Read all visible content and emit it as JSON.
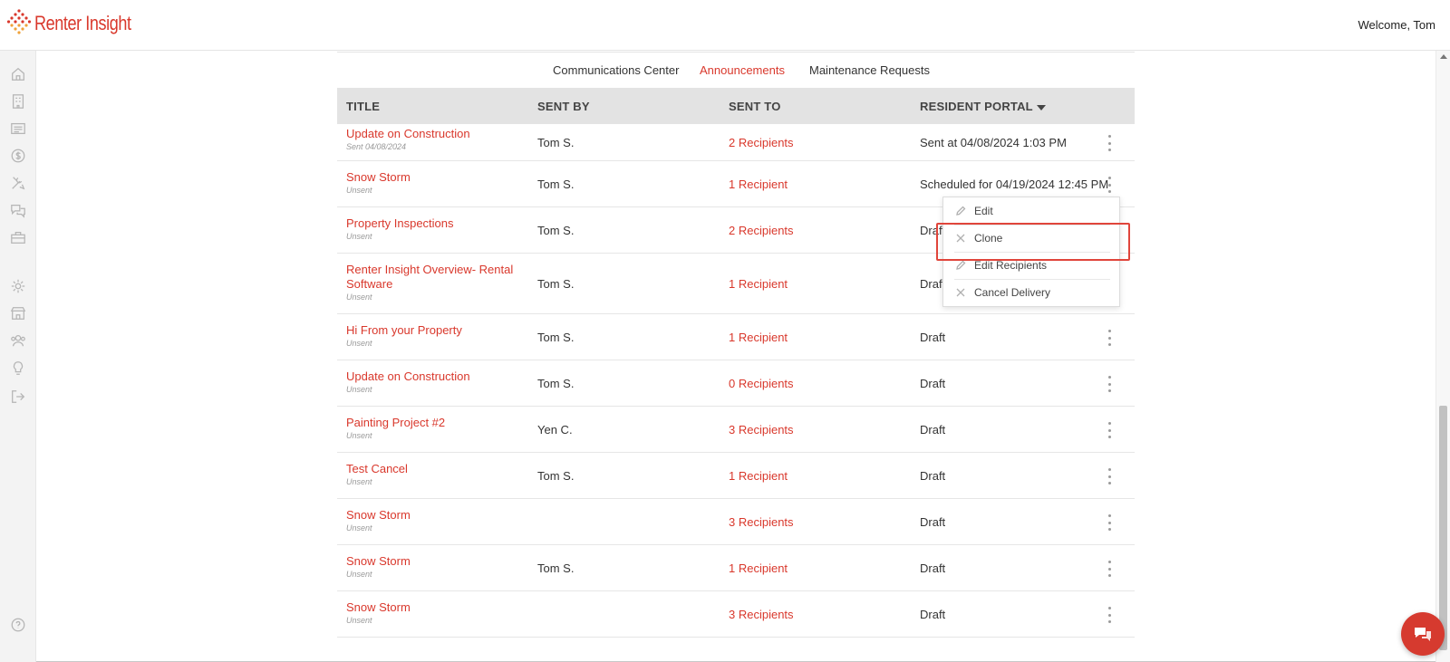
{
  "app": {
    "brand": "Renter Insight",
    "welcome": "Welcome, Tom",
    "accent": "#d9382c"
  },
  "sidebar": {
    "icons": [
      "home-icon",
      "building-icon",
      "list-icon",
      "dollar-icon",
      "tools-icon",
      "chat-icon",
      "toolbox-icon",
      "gear-icon",
      "store-icon",
      "users-icon",
      "lightbulb-icon",
      "logout-icon",
      "help-icon"
    ]
  },
  "tabs": [
    {
      "label": "Communications Center",
      "active": false
    },
    {
      "label": "Announcements",
      "active": true
    },
    {
      "label": "Maintenance Requests",
      "active": false
    }
  ],
  "table": {
    "columns": [
      "TITLE",
      "SENT BY",
      "SENT TO",
      "RESIDENT PORTAL"
    ],
    "sort_column": "RESIDENT PORTAL",
    "rows": [
      {
        "title": "Update on Construction",
        "sub": "Sent 04/08/2024",
        "sent_by": "Tom S.",
        "sent_to": "2 Recipients",
        "portal": "Sent at 04/08/2024 1:03 PM"
      },
      {
        "title": "Snow Storm",
        "sub": "Unsent",
        "sent_by": "Tom S.",
        "sent_to": "1 Recipient",
        "portal": "Scheduled for 04/19/2024 12:45 PM"
      },
      {
        "title": "Property Inspections",
        "sub": "Unsent",
        "sent_by": "Tom S.",
        "sent_to": "2 Recipients",
        "portal": "Draft"
      },
      {
        "title": "Renter Insight Overview- Rental Software",
        "sub": "Unsent",
        "sent_by": "Tom S.",
        "sent_to": "1 Recipient",
        "portal": "Draft"
      },
      {
        "title": "Hi From your Property",
        "sub": "Unsent",
        "sent_by": "Tom S.",
        "sent_to": "1 Recipient",
        "portal": "Draft"
      },
      {
        "title": "Update on Construction",
        "sub": "Unsent",
        "sent_by": "Tom S.",
        "sent_to": "0 Recipients",
        "portal": "Draft"
      },
      {
        "title": "Painting Project #2",
        "sub": "Unsent",
        "sent_by": "Yen C.",
        "sent_to": "3 Recipients",
        "portal": "Draft"
      },
      {
        "title": "Test Cancel",
        "sub": "Unsent",
        "sent_by": "Tom S.",
        "sent_to": "1 Recipient",
        "portal": "Draft"
      },
      {
        "title": "Snow Storm",
        "sub": "Unsent",
        "sent_by": "",
        "sent_to": "3 Recipients",
        "portal": "Draft"
      },
      {
        "title": "Snow Storm",
        "sub": "Unsent",
        "sent_by": "Tom S.",
        "sent_to": "1 Recipient",
        "portal": "Draft"
      },
      {
        "title": "Snow Storm",
        "sub": "Unsent",
        "sent_by": "",
        "sent_to": "3 Recipients",
        "portal": "Draft"
      }
    ]
  },
  "menu": {
    "items": [
      {
        "label": "Edit",
        "icon": "pencil-icon"
      },
      {
        "label": "Clone",
        "icon": "x-icon"
      },
      {
        "label": "Edit Recipients",
        "icon": "pencil-icon"
      },
      {
        "label": "Cancel Delivery",
        "icon": "x-icon"
      }
    ],
    "highlighted": "Clone"
  },
  "chat": {
    "icon": "chat-bubble-icon"
  }
}
